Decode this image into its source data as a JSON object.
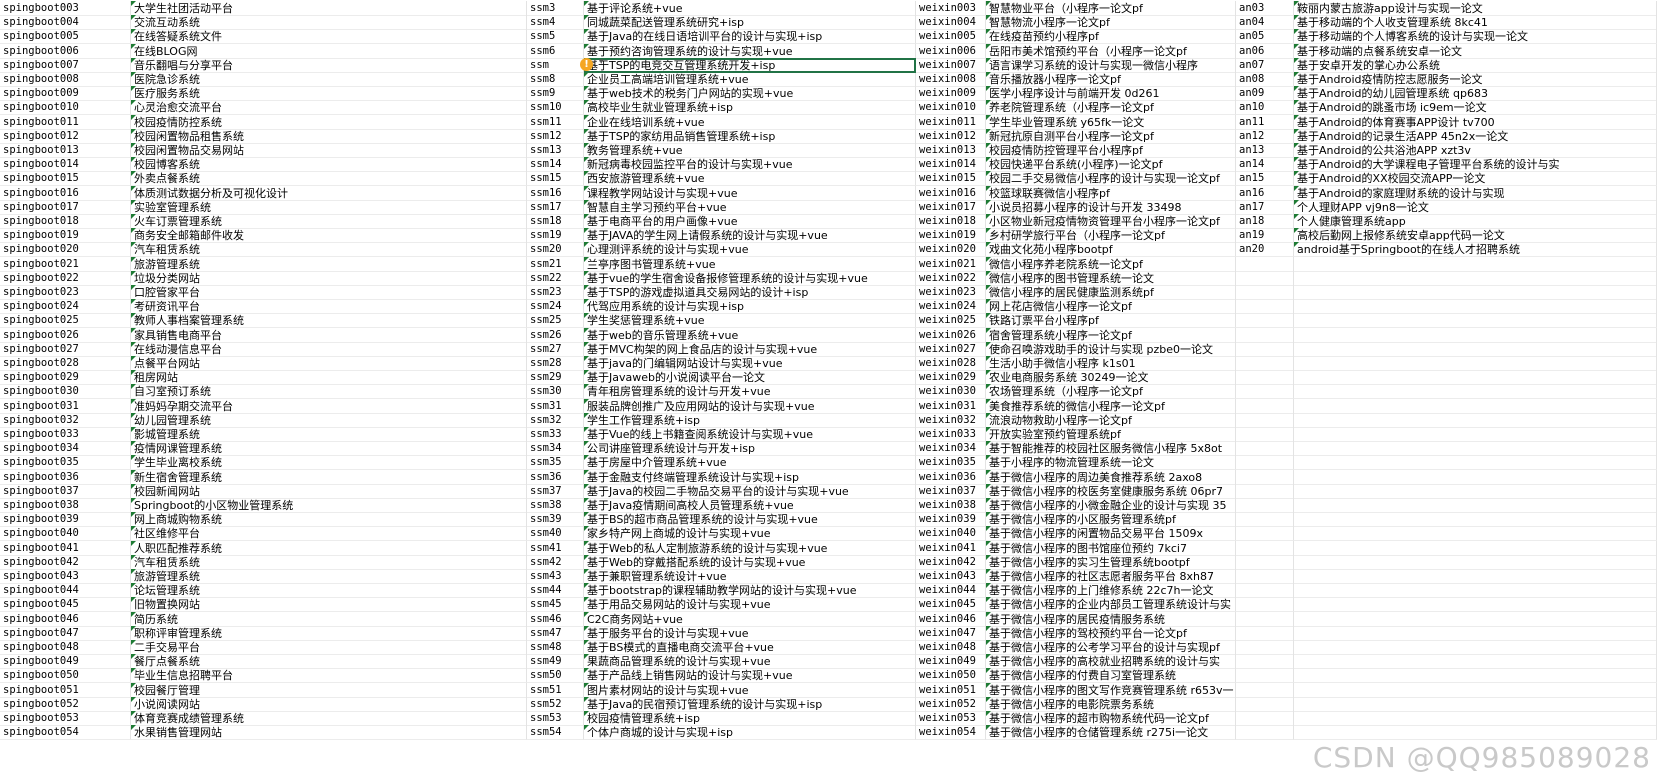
{
  "watermark": "CSDN @QQ985089028",
  "rows": [
    [
      "spingboot003",
      "大学生社团活动平台",
      "ssm3",
      "基于评论系统+vue",
      "weixin003",
      "智慧物业平台（小程序一论文pf",
      "an03",
      "鞍丽内蒙古旅游app设计与实现一论文"
    ],
    [
      "spingboot004",
      "交流互动系统",
      "ssm4",
      "同城蔬菜配送管理系统研究+isp",
      "weixin004",
      "智慧物流小程序一论文pf",
      "an04",
      "基于移动端的个人收支管理系统 8kc41"
    ],
    [
      "spingboot005",
      "在线答疑系统文件",
      "ssm5",
      "基于Java的在线日语培训平台的设计与实现+isp",
      "weixin005",
      "在线疫苗预约小程序pf",
      "an05",
      "基于移动端的个人博客系统的设计与实现一论文"
    ],
    [
      "spingboot006",
      "在线BLOG网",
      "ssm6",
      "基于预约咨询管理系统的设计与实现+vue",
      "weixin006",
      "岳阳市美术馆预约平台（小程序一论文pf",
      "an06",
      "基于移动端的点餐系统安卓一论文"
    ],
    [
      "spingboot007",
      "音乐翻唱与分享平台",
      "ssm",
      "基于TSP的电竞交互管理系统开发+isp",
      "weixin007",
      "语言课学习系统的设计与实现一微信小程序",
      "an07",
      "基于安卓开发的掌心办公系统"
    ],
    [
      "spingboot008",
      "医院急诊系统",
      "ssm8",
      "企业员工高端培训管理系统+vue",
      "weixin008",
      "音乐播放器小程序一论文pf",
      "an08",
      "基于Android疫情防控志愿服务一论文"
    ],
    [
      "spingboot009",
      "医疗服务系统",
      "ssm9",
      "基于web技术的税务门户网站的实现+vue",
      "weixin009",
      "医学小程序设计与前端开发 0d261",
      "an09",
      "基于Android的幼儿园管理系统 qp683"
    ],
    [
      "spingboot010",
      "心灵治愈交流平台",
      "ssm10",
      "高校毕业生就业管理系统+isp",
      "weixin010",
      "养老院管理系统（小程序一论文pf",
      "an10",
      "基于Android的跳蚤市场 ic9em一论文"
    ],
    [
      "spingboot011",
      "校园疫情防控系统",
      "ssm11",
      "企业在线培训系统+vue",
      "weixin011",
      "学生毕业管理系统 y65fk一论文",
      "an11",
      "基于Android的体育赛事APP设计 tv700"
    ],
    [
      "spingboot012",
      "校园闲置物品租售系统",
      "ssm12",
      "基于TSP的家纺用品销售管理系统+isp",
      "weixin012",
      "新冠抗原自测平台小程序一论文pf",
      "an12",
      "基于Android的记录生活APP 45n2x一论文"
    ],
    [
      "spingboot013",
      "校园闲置物品交易网站",
      "ssm13",
      "教务管理系统+vue",
      "weixin013",
      "校园疫情防控管理平台小程序pf",
      "an13",
      "基于Android的公共浴池APP xzt3v"
    ],
    [
      "spingboot014",
      "校园博客系统",
      "ssm14",
      "新冠病毒校园监控平台的设计与实现+vue",
      "weixin014",
      "校园快递平台系统(小程序)一论文pf",
      "an14",
      "基于Android的大学课程电子管理平台系统的设计与实"
    ],
    [
      "spingboot015",
      "外卖点餐系统",
      "ssm15",
      "西安旅游管理系统+vue",
      "weixin015",
      "校园二手交易微信小程序的设计与实现一论文pf",
      "an15",
      "基于Android的XX校园交流APP一论文"
    ],
    [
      "spingboot016",
      "体质测试数据分析及可视化设计",
      "ssm16",
      "课程教学网站设计与实现+vue",
      "weixin016",
      "校篮球联赛微信小程序pf",
      "an16",
      "基于Android的家庭理财系统的设计与实现"
    ],
    [
      "spingboot017",
      "实验室管理系统",
      "ssm17",
      "智慧自主学习预约平台+vue",
      "weixin017",
      "小说员招募小程序的设计与开发 33498",
      "an17",
      "个人理财APP vj9n8一论文"
    ],
    [
      "spingboot018",
      "火车订票管理系统",
      "ssm18",
      "基于电商平台的用户画像+vue",
      "weixin018",
      "小区物业新冠疫情物资管理平台小程序一论文pf",
      "an18",
      "个人健康管理系统app"
    ],
    [
      "spingboot019",
      "商务安全邮箱邮件收发",
      "ssm19",
      "基于JAVA的学生网上请假系统的设计与实现+vue",
      "weixin019",
      "乡村研学旅行平台（小程序一论文pf",
      "an19",
      "高校后勤网上报修系统安卓app代码一论文"
    ],
    [
      "spingboot020",
      "汽车租赁系统",
      "ssm20",
      "心理测评系统的设计与实现+vue",
      "weixin020",
      "戏曲文化苑小程序bootpf",
      "an20",
      "android基于Springboot的在线人才招聘系统"
    ],
    [
      "spingboot021",
      "旅游管理系统",
      "ssm21",
      "兰亭序图书管理系统+vue",
      "weixin021",
      "微信小程序养老院系统一论文pf",
      "",
      ""
    ],
    [
      "spingboot022",
      "垃圾分类网站",
      "ssm22",
      "基于vue的学生宿舍设备报修管理系统的设计与实现+vue",
      "weixin022",
      "微信小程序的图书管理系统一论文",
      "",
      ""
    ],
    [
      "spingboot023",
      "口腔管家平台",
      "ssm23",
      "基于TSP的游戏虚拟道具交易网站的设计+isp",
      "weixin023",
      "微信小程序的居民健康监测系统pf",
      "",
      ""
    ],
    [
      "spingboot024",
      "考研资讯平台",
      "ssm24",
      "代驾应用系统的设计与实现+isp",
      "weixin024",
      "网上花店微信小程序一论文pf",
      "",
      ""
    ],
    [
      "spingboot025",
      "教师人事档案管理系统",
      "ssm25",
      "学生奖惩管理系统+vue",
      "weixin025",
      "铁路订票平台小程序pf",
      "",
      ""
    ],
    [
      "spingboot026",
      "家具销售电商平台",
      "ssm26",
      "基于web的音乐管理系统+vue",
      "weixin026",
      "宿舍管理系统小程序一论文pf",
      "",
      ""
    ],
    [
      "spingboot027",
      "在线动漫信息平台",
      "ssm27",
      "基于MVC构架的网上食品店的设计与实现+vue",
      "weixin027",
      "使命召唤游戏助手的设计与实现 pzbe0一论文",
      "",
      ""
    ],
    [
      "spingboot028",
      "点餐平台网站",
      "ssm28",
      "基于java的门编辑网站设计与实现+vue",
      "weixin028",
      "生活小助手微信小程序 k1s01",
      "",
      ""
    ],
    [
      "spingboot029",
      "租房网站",
      "ssm29",
      "基于Javaweb的小说阅读平台一论文",
      "weixin029",
      "农业电商服务系统 30249一论文",
      "",
      ""
    ],
    [
      "spingboot030",
      "自习室预订系统",
      "ssm30",
      "青年租房管理系统的设计与开发+vue",
      "weixin030",
      "农场管理系统（小程序一论文pf",
      "",
      ""
    ],
    [
      "spingboot031",
      "准妈妈孕期交流平台",
      "ssm31",
      "服装品牌创推广及应用网站的设计与实现+vue",
      "weixin031",
      "美食推荐系统的微信小程序一论文pf",
      "",
      ""
    ],
    [
      "spingboot032",
      "幼儿园管理系统",
      "ssm32",
      "学生工作管理系统+isp",
      "weixin032",
      "流浪动物救助小程序一论文pf",
      "",
      ""
    ],
    [
      "spingboot033",
      "影城管理系统",
      "ssm33",
      "基于Vue的线上书籍查阅系统设计与实现+vue",
      "weixin033",
      "开放实验室预约管理系统pf",
      "",
      ""
    ],
    [
      "spingboot034",
      "疫情网课管理系统",
      "ssm34",
      "公司讲座管理系统设计与开发+isp",
      "weixin034",
      "基于智能推荐的校园社区服务微信小程序 5x8ot",
      "",
      ""
    ],
    [
      "spingboot035",
      "学生毕业离校系统",
      "ssm35",
      "基于房屋中介管理系统+vue",
      "weixin035",
      "基于小程序的物流管理系统一论文",
      "",
      ""
    ],
    [
      "spingboot036",
      "新生宿舍管理系统",
      "ssm36",
      "基于金融支付终端管理系统设计与实现+isp",
      "weixin036",
      "基于微信小程序的周边美食推荐系统 2axo8",
      "",
      ""
    ],
    [
      "spingboot037",
      "校园新闻网站",
      "ssm37",
      "基于Java的校园二手物品交易平台的设计与实现+vue",
      "weixin037",
      "基于微信小程序的校医务室健康服务系统 06pr7",
      "",
      ""
    ],
    [
      "spingboot038",
      "Springboot的小区物业管理系统",
      "ssm38",
      "基于Java疫情期间高校人员管理系统+vue",
      "weixin038",
      "基于微信小程序的小微金融企业的设计与实现 35",
      "",
      ""
    ],
    [
      "spingboot039",
      "网上商城购物系统",
      "ssm39",
      "基于BS的超市商品管理系统的设计与实现+vue",
      "weixin039",
      "基于微信小程序的小区服务管理系统pf",
      "",
      ""
    ],
    [
      "spingboot040",
      "社区维修平台",
      "ssm40",
      "家乡特产网上商城的设计与实现+vue",
      "weixin040",
      "基于微信小程序的闲置物品交易平台 1509x",
      "",
      ""
    ],
    [
      "spingboot041",
      "人职匹配推荐系统",
      "ssm41",
      "基于Web的私人定制旅游系统的设计与实现+vue",
      "weixin041",
      "基于微信小程序的图书馆座位预约 7kci7",
      "",
      ""
    ],
    [
      "spingboot042",
      "汽车租赁系统",
      "ssm42",
      "基于Web的穿戴搭配系统的设计与实现+vue",
      "weixin042",
      "基于微信小程序的实习生管理系统bootpf",
      "",
      ""
    ],
    [
      "spingboot043",
      "旅游管理系统",
      "ssm43",
      "基于兼职管理系统设计+vue",
      "weixin043",
      "基于微信小程序的社区志愿者服务平台 8xh87",
      "",
      ""
    ],
    [
      "spingboot044",
      "论坛管理系统",
      "ssm44",
      "基于bootstrap的课程辅助教学网站的设计与实现+vue",
      "weixin044",
      "基于微信小程序的上门维修系统 22c7h一论文",
      "",
      ""
    ],
    [
      "spingboot045",
      "旧物置换网站",
      "ssm45",
      "基于用品交易网站的设计与实现+vue",
      "weixin045",
      "基于微信小程序的企业内部员工管理系统设计与实",
      "",
      ""
    ],
    [
      "spingboot046",
      "简历系统",
      "ssm46",
      "C2C商务网站+vue",
      "weixin046",
      "基于微信小程序的居民疫情服务系统",
      "",
      ""
    ],
    [
      "spingboot047",
      "职称评审管理系统",
      "ssm47",
      "基于服务平台的设计与实现+vue",
      "weixin047",
      "基于微信小程序的驾校预约平台一论文pf",
      "",
      ""
    ],
    [
      "spingboot048",
      "二手交易平台",
      "ssm48",
      "基于BS模式的直播电商交流平台+vue",
      "weixin048",
      "基于微信小程序的公考学习平台的设计与实现pf",
      "",
      ""
    ],
    [
      "spingboot049",
      "餐厅点餐系统",
      "ssm49",
      "果蔬商品管理系统的设计与实现+vue",
      "weixin049",
      "基于微信小程序的高校就业招聘系统的设计与实",
      "",
      ""
    ],
    [
      "spingboot050",
      "毕业生信息招聘平台",
      "ssm50",
      "基于产品线上销售网站的设计与实现+vue",
      "weixin050",
      "基于微信小程序的付费自习室管理系统",
      "",
      ""
    ],
    [
      "spingboot051",
      "校园餐厅管理",
      "ssm51",
      "图片素材网站的设计与实现+vue",
      "weixin051",
      "基于微信小程序的图文写作竞赛管理系统 r653v一",
      "",
      ""
    ],
    [
      "spingboot052",
      "小说阅读网站",
      "ssm52",
      "基于Java的民宿预订管理系统的设计与实现+isp",
      "weixin052",
      "基于微信小程序的电影院票务系统",
      "",
      ""
    ],
    [
      "spingboot053",
      "体育竞赛成绩管理系统",
      "ssm53",
      "校园疫情管理系统+isp",
      "weixin053",
      "基于微信小程序的超市购物系统代码一论文pf",
      "",
      ""
    ],
    [
      "spingboot054",
      "水果销售管理网站",
      "ssm54",
      "个体户商城的设计与实现+isp",
      "weixin054",
      "基于微信小程序的仓储管理系统 r275i一论文",
      "",
      ""
    ]
  ]
}
